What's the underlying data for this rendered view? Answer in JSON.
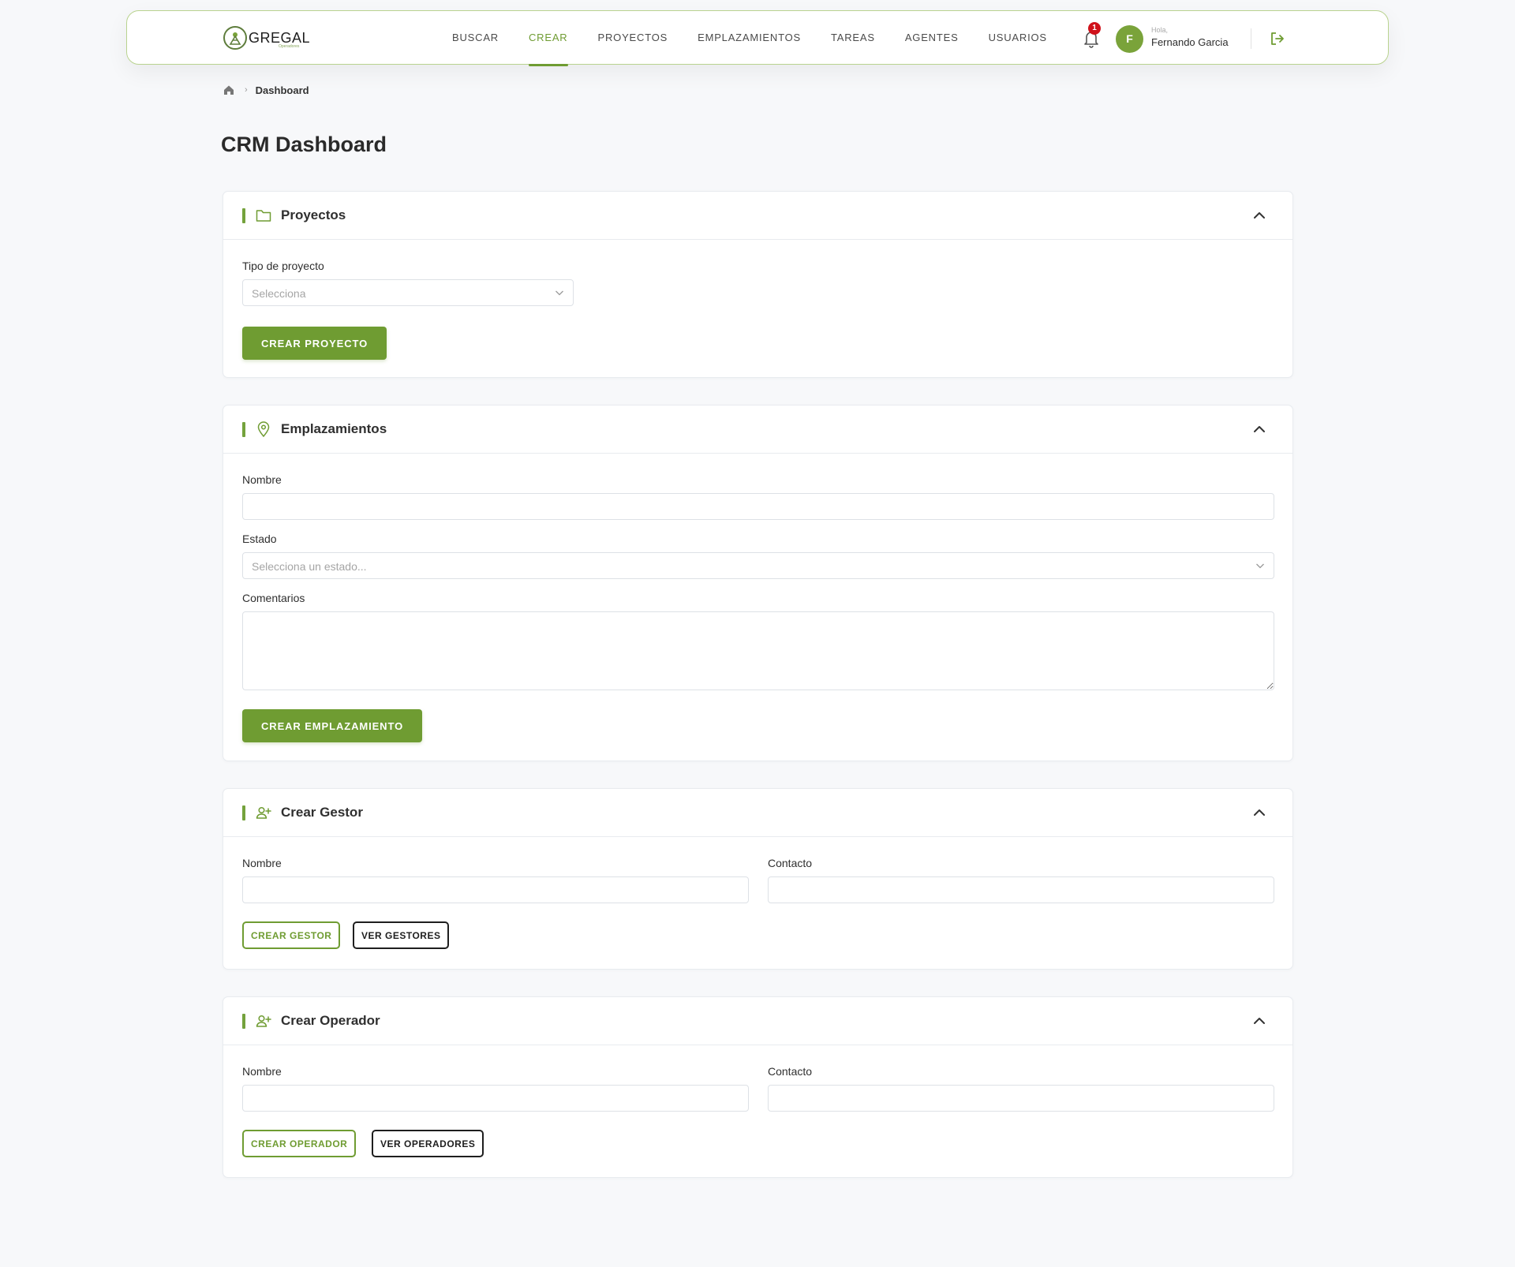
{
  "brand": {
    "name": "GREGAL",
    "tagline": "Operadores"
  },
  "nav": {
    "links": [
      "BUSCAR",
      "CREAR",
      "PROYECTOS",
      "EMPLAZAMIENTOS",
      "TAREAS",
      "AGENTES",
      "USUARIOS"
    ],
    "active": "CREAR",
    "notification_count": "1",
    "user": {
      "initial": "F",
      "greeting": "Hola,",
      "name": "Fernando Garcia"
    }
  },
  "breadcrumb": {
    "current": "Dashboard"
  },
  "page": {
    "title": "CRM Dashboard"
  },
  "proyectos": {
    "title": "Proyectos",
    "tipo_label": "Tipo de proyecto",
    "tipo_placeholder": "Selecciona",
    "button": "CREAR PROYECTO"
  },
  "emplazamientos": {
    "title": "Emplazamientos",
    "nombre_label": "Nombre",
    "nombre_value": "",
    "estado_label": "Estado",
    "estado_placeholder": "Selecciona un estado...",
    "comentarios_label": "Comentarios",
    "comentarios_value": "",
    "button": "CREAR EMPLAZAMIENTO"
  },
  "gestor": {
    "title": "Crear Gestor",
    "nombre_label": "Nombre",
    "contacto_label": "Contacto",
    "create_button": "CREAR GESTOR",
    "view_button": "VER GESTORES"
  },
  "operador": {
    "title": "Crear Operador",
    "nombre_label": "Nombre",
    "contacto_label": "Contacto",
    "create_button": "CREAR OPERADOR",
    "view_button": "VER OPERADORES"
  },
  "colors": {
    "accent": "#6f9c32",
    "badge": "#d0121b",
    "border": "#dde1e6"
  },
  "icons": [
    "logo-icon",
    "bell-icon",
    "logout-icon",
    "home-icon",
    "folder-icon",
    "location-pin-icon",
    "user-plus-icon",
    "chevron-up-icon",
    "chevron-down-icon"
  ]
}
